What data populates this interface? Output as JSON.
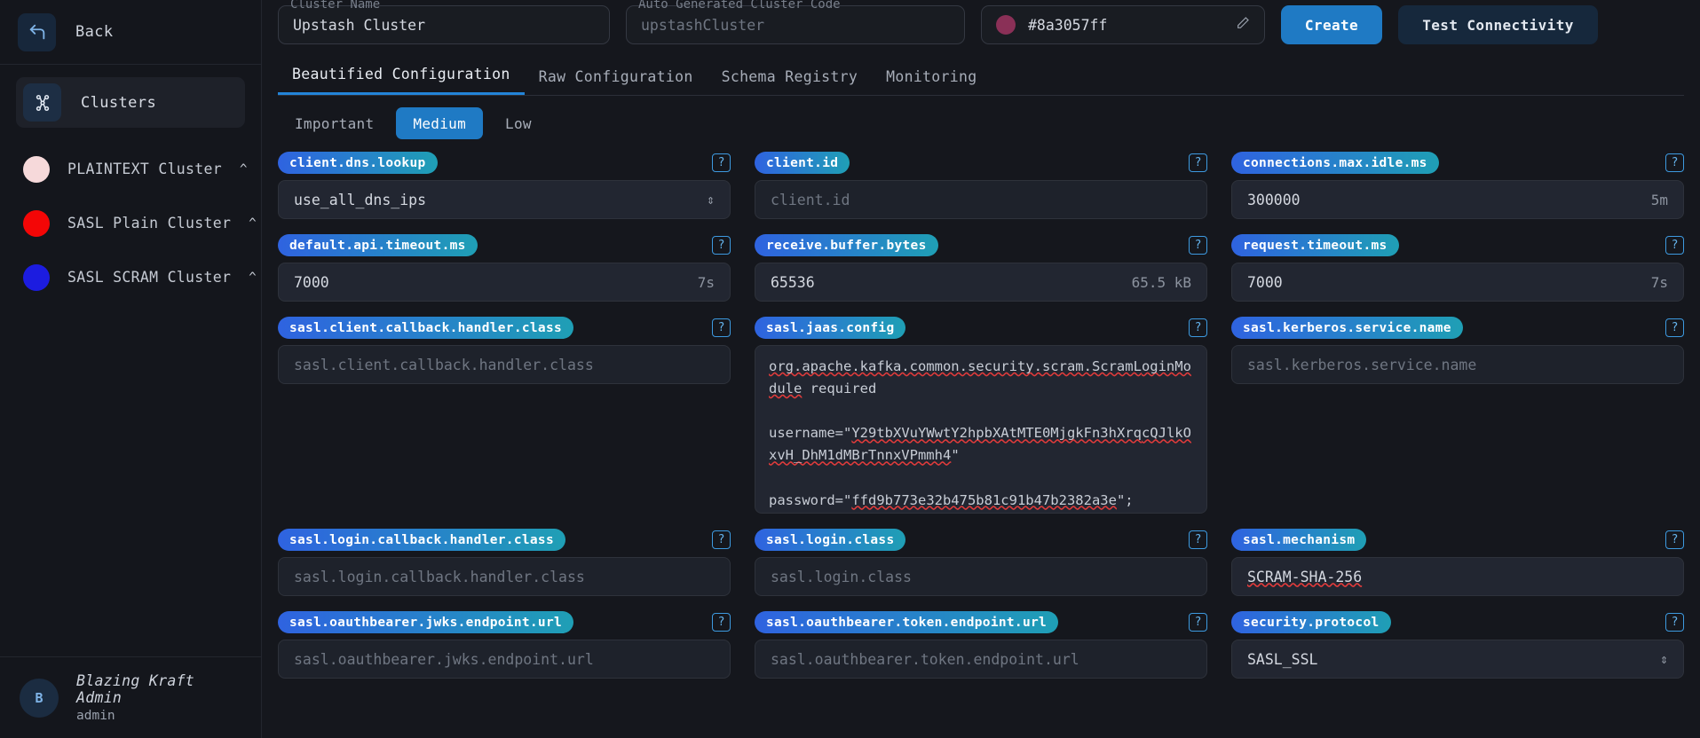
{
  "sidebar": {
    "back_label": "Back",
    "back_icon": "arrow-back-icon",
    "nav_active": {
      "label": "Clusters",
      "icon": "clusters-icon"
    },
    "clusters": [
      {
        "label": "PLAINTEXT Cluster",
        "color": "#f6d9da",
        "chevron": "^"
      },
      {
        "label": "SASL Plain Cluster",
        "color": "#f40606",
        "chevron": "^"
      },
      {
        "label": "SASL SCRAM Cluster",
        "color": "#1c1ce0",
        "chevron": "^"
      }
    ],
    "user": {
      "initial": "B",
      "name": "Blazing Kraft Admin",
      "role": "admin"
    }
  },
  "topbar": {
    "cluster_name": {
      "label": "Cluster Name",
      "value": "Upstash Cluster"
    },
    "cluster_code": {
      "label": "Auto Generated Cluster Code",
      "placeholder": "upstashCluster",
      "value": ""
    },
    "color": {
      "value": "#8a3057ff",
      "swatch": "#8a3057",
      "edit_icon": "pencil-icon"
    },
    "create_label": "Create",
    "test_label": "Test Connectivity"
  },
  "tabs": [
    {
      "label": "Beautified Configuration",
      "active": true
    },
    {
      "label": "Raw Configuration",
      "active": false
    },
    {
      "label": "Schema Registry",
      "active": false
    },
    {
      "label": "Monitoring",
      "active": false
    }
  ],
  "severity": [
    {
      "label": "Important",
      "active": false
    },
    {
      "label": "Medium",
      "active": true
    },
    {
      "label": "Low",
      "active": false
    }
  ],
  "fields": [
    {
      "key": "client.dns.lookup",
      "value": "use_all_dns_ips",
      "placeholder": "",
      "type": "select",
      "suffix": ""
    },
    {
      "key": "client.id",
      "value": "",
      "placeholder": "client.id",
      "type": "text",
      "suffix": ""
    },
    {
      "key": "connections.max.idle.ms",
      "value": "300000",
      "placeholder": "",
      "type": "text",
      "suffix": "5m"
    },
    {
      "key": "default.api.timeout.ms",
      "value": "7000",
      "placeholder": "",
      "type": "text",
      "suffix": "7s"
    },
    {
      "key": "receive.buffer.bytes",
      "value": "65536",
      "placeholder": "",
      "type": "text",
      "suffix": "65.5 kB"
    },
    {
      "key": "request.timeout.ms",
      "value": "7000",
      "placeholder": "",
      "type": "text",
      "suffix": "7s"
    },
    {
      "key": "sasl.client.callback.handler.class",
      "value": "",
      "placeholder": "sasl.client.callback.handler.class",
      "type": "text",
      "suffix": ""
    },
    {
      "key": "sasl.jaas.config",
      "value": "",
      "placeholder": "",
      "type": "textarea",
      "suffix": ""
    },
    {
      "key": "sasl.kerberos.service.name",
      "value": "",
      "placeholder": "sasl.kerberos.service.name",
      "type": "text",
      "suffix": ""
    },
    {
      "key": "sasl.login.callback.handler.class",
      "value": "",
      "placeholder": "sasl.login.callback.handler.class",
      "type": "text",
      "suffix": ""
    },
    {
      "key": "sasl.login.class",
      "value": "",
      "placeholder": "sasl.login.class",
      "type": "text",
      "suffix": ""
    },
    {
      "key": "sasl.mechanism",
      "value": "SCRAM-SHA-256",
      "placeholder": "",
      "type": "text",
      "suffix": ""
    },
    {
      "key": "sasl.oauthbearer.jwks.endpoint.url",
      "value": "",
      "placeholder": "sasl.oauthbearer.jwks.endpoint.url",
      "type": "text",
      "suffix": ""
    },
    {
      "key": "sasl.oauthbearer.token.endpoint.url",
      "value": "",
      "placeholder": "sasl.oauthbearer.token.endpoint.url",
      "type": "text",
      "suffix": ""
    },
    {
      "key": "security.protocol",
      "value": "SASL_SSL",
      "placeholder": "",
      "type": "select",
      "suffix": ""
    }
  ],
  "jaas": {
    "line1a": "org.apache.kafka.common.security.scram.ScramL",
    "line1b": "oginModule",
    "line1c": " required",
    "username_prefix": "username=\"",
    "username_part1": "Y29tbXVuYWwtY2hpbXAtMTE0MjgkFn3hXrq",
    "username_part2": "cQJlkOxvH_DhM1dMBrTnnxVPmmh4",
    "username_suffix": "\"",
    "password_prefix": "password=\"",
    "password_value": "ffd9b773e32b475b81c91b47b2382a3e",
    "password_suffix": "\";"
  },
  "help_glyph": "?",
  "select_caret": "⌃⌄"
}
